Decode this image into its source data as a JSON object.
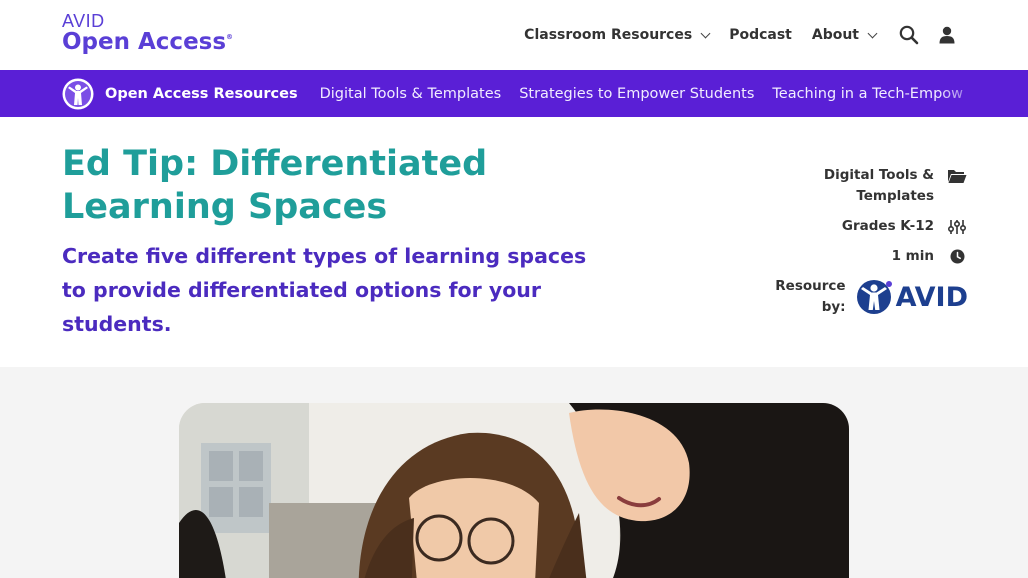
{
  "header": {
    "logo_top": "AVID",
    "logo_bottom": "Open Access",
    "logo_mark": "®",
    "nav": [
      {
        "label": "Classroom Resources",
        "has_dropdown": true
      },
      {
        "label": "Podcast",
        "has_dropdown": false
      },
      {
        "label": "About",
        "has_dropdown": true
      }
    ],
    "icons": [
      "search-icon",
      "user-icon"
    ]
  },
  "subnav": {
    "title": "Open Access Resources",
    "links": [
      "Digital Tools & Templates",
      "Strategies to Empower Students",
      "Teaching in a Tech-Empow"
    ],
    "color": "#5a1fd6"
  },
  "article": {
    "title": "Ed Tip: Differentiated Learning Spaces",
    "subtitle": "Create five different types of learning spaces to provide differentiated options for your students.",
    "title_color": "#1f9e9a",
    "subtitle_color": "#4b2bbf"
  },
  "meta": {
    "category": "Digital Tools & Templates",
    "grades": "Grades K-12",
    "duration": "1 min",
    "resource_by_label": "Resource by:",
    "resource_by_logo_text": "AVID",
    "icons": [
      "folder-icon",
      "sliders-icon",
      "clock-icon"
    ]
  }
}
